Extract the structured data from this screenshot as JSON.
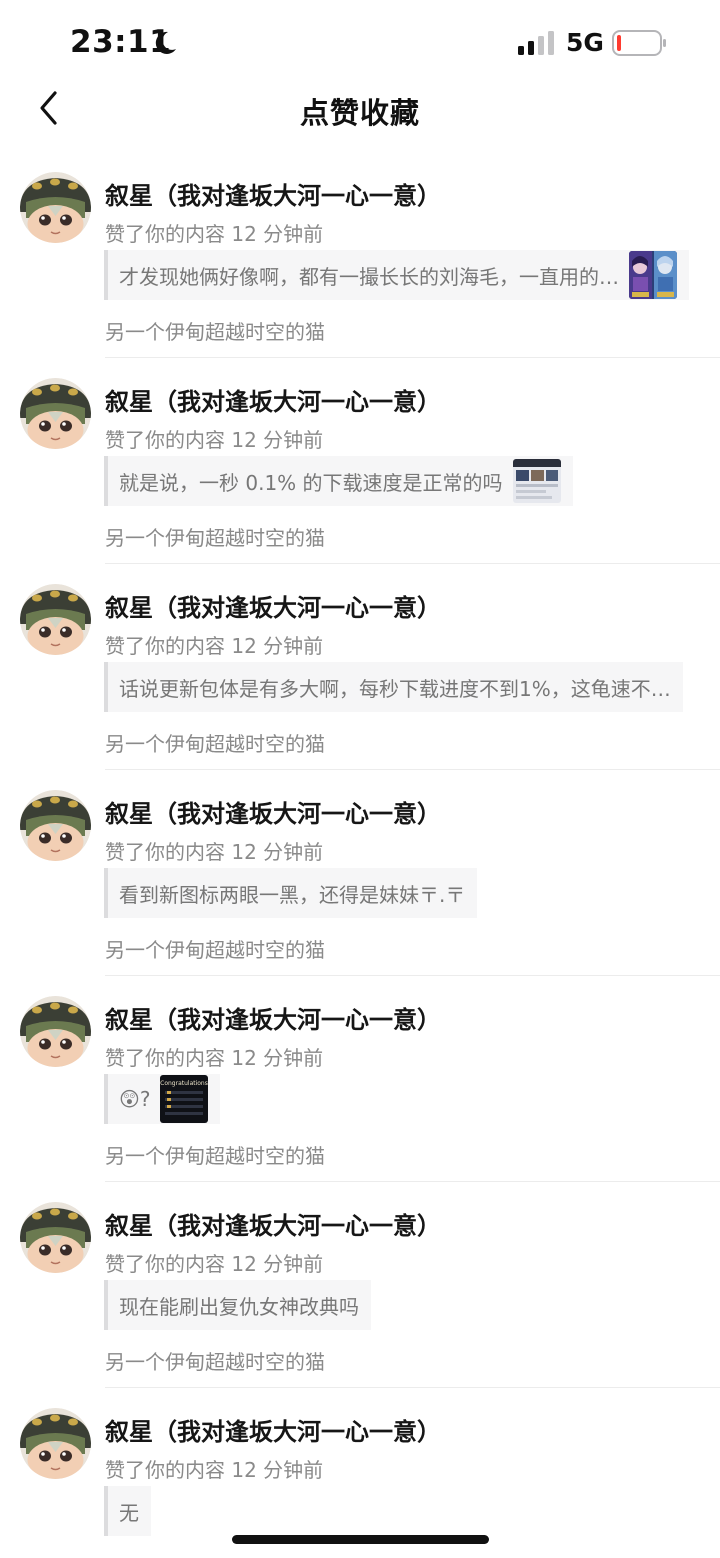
{
  "status_bar": {
    "time": "23:11",
    "network": "5G",
    "moon_icon": "moon-icon",
    "signal_icon": "cellular-signal-icon",
    "battery_icon": "battery-icon",
    "battery_color": "#ff3b30"
  },
  "nav": {
    "title": "点赞收藏",
    "back_icon": "chevron-left-icon"
  },
  "notifications": [
    {
      "user": "叙星（我对逢坂大河一心一意）",
      "action": "赞了你的内容 12 分钟前",
      "content": "才发现她俩好像啊，都有一撮长长的刘海毛，一直用的…",
      "thumbnail": "anime-characters-thumbnail",
      "source": "另一个伊甸超越时空的猫"
    },
    {
      "user": "叙星（我对逢坂大河一心一意）",
      "action": "赞了你的内容 12 分钟前",
      "content": "就是说，一秒 0.1% 的下载速度是正常的吗",
      "thumbnail": "screenshot-thumbnail",
      "source": "另一个伊甸超越时空的猫"
    },
    {
      "user": "叙星（我对逢坂大河一心一意）",
      "action": "赞了你的内容 12 分钟前",
      "content": "话说更新包体是有多大啊，每秒下载进度不到1%，这龟速不…",
      "thumbnail": "",
      "source": "另一个伊甸超越时空的猫"
    },
    {
      "user": "叙星（我对逢坂大河一心一意）",
      "action": "赞了你的内容 12 分钟前",
      "content": "看到新图标两眼一黑，还得是妹妹〒.〒",
      "thumbnail": "",
      "source": "另一个伊甸超越时空的猫"
    },
    {
      "user": "叙星（我对逢坂大河一心一意）",
      "action": "赞了你的内容 12 分钟前",
      "content": "😲?",
      "thumbnail": "congratulations-thumbnail",
      "thumbnail_text": "Congratulations",
      "source": "另一个伊甸超越时空的猫"
    },
    {
      "user": "叙星（我对逢坂大河一心一意）",
      "action": "赞了你的内容 12 分钟前",
      "content": "现在能刷出复仇女神改典吗",
      "thumbnail": "",
      "source": "另一个伊甸超越时空的猫"
    },
    {
      "user": "叙星（我对逢坂大河一心一意）",
      "action": "赞了你的内容 12 分钟前",
      "content": "无",
      "thumbnail": "",
      "source": "另一个伊甸超越时空的猫"
    }
  ]
}
